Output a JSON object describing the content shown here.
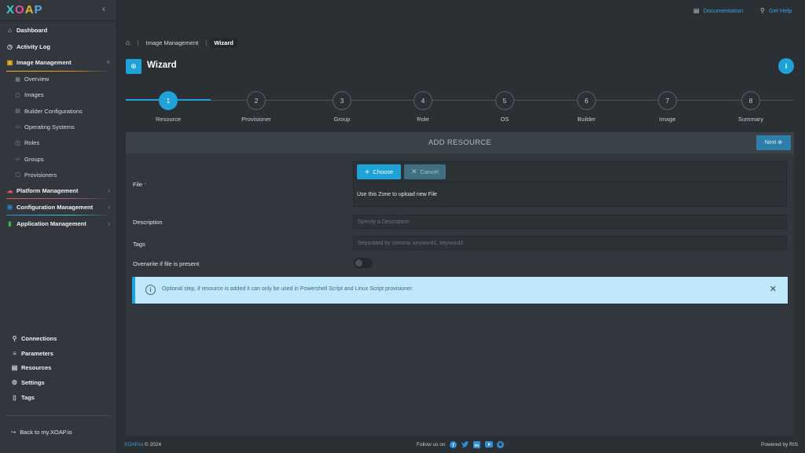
{
  "app": {
    "logo": [
      "X",
      "O",
      "A",
      "P"
    ],
    "collapse_glyph": "‹"
  },
  "sidebar": {
    "main_items": [
      {
        "label": "Dashboard",
        "icon": "home-icon"
      },
      {
        "label": "Activity Log",
        "icon": "clock-icon"
      }
    ],
    "image_management": {
      "label": "Image Management",
      "icon": "layers-icon",
      "accent": "#f0b429",
      "children": [
        {
          "label": "Overview",
          "icon": "grid-icon"
        },
        {
          "label": "Images",
          "icon": "image-icon"
        },
        {
          "label": "Builder Configurations",
          "icon": "file-icon"
        },
        {
          "label": "Operating Systems",
          "icon": "monitor-icon"
        },
        {
          "label": "Roles",
          "icon": "cube-icon"
        },
        {
          "label": "Groups",
          "icon": "folder-icon"
        },
        {
          "label": "Provisioners",
          "icon": "box-icon"
        }
      ]
    },
    "sections": [
      {
        "label": "Platform Management",
        "icon": "cloud-icon",
        "accent": "#e05a4f"
      },
      {
        "label": "Configuration Management",
        "icon": "windows-icon",
        "accent": "#2f8fd8"
      },
      {
        "label": "Application Management",
        "icon": "bar-chart-icon",
        "accent": "#3ab54a"
      }
    ],
    "bottom_items": [
      {
        "label": "Connections",
        "icon": "link-icon"
      },
      {
        "label": "Parameters",
        "icon": "sliders-icon"
      },
      {
        "label": "Resources",
        "icon": "database-icon"
      },
      {
        "label": "Settings",
        "icon": "gear-icon"
      },
      {
        "label": "Tags",
        "icon": "bookmark-icon"
      }
    ],
    "back_link": "Back to my.XOAP.io"
  },
  "topbar": {
    "documentation": "Documentation",
    "get_help": "Get Help"
  },
  "breadcrumb": {
    "items": [
      "Image Management",
      "Wizard"
    ]
  },
  "page": {
    "title": "Wizard",
    "info_glyph": "i"
  },
  "stepper": {
    "current": 1,
    "steps": [
      {
        "number": "1",
        "label": "Resource"
      },
      {
        "number": "2",
        "label": "Provisioner"
      },
      {
        "number": "3",
        "label": "Group"
      },
      {
        "number": "4",
        "label": "Role"
      },
      {
        "number": "5",
        "label": "OS"
      },
      {
        "number": "6",
        "label": "Builder"
      },
      {
        "number": "7",
        "label": "Image"
      },
      {
        "number": "8",
        "label": "Summary"
      }
    ]
  },
  "form": {
    "header": "ADD RESOURCE",
    "next_label": "Next",
    "file_label": "File",
    "required_mark": "*",
    "choose_label": "Choose",
    "cancel_label": "Cancel",
    "upload_hint": "Use this Zone to upload new File",
    "description_label": "Description",
    "description_placeholder": "Specify a Description",
    "description_value": "",
    "tags_label": "Tags",
    "tags_placeholder": "Separated by comma: keyword1, keyword2",
    "tags_value": "",
    "overwrite_label": "Overwrite if file is present",
    "overwrite_on": false,
    "alert_message": "Optional step, if resource is added it can only be used in Powershell Script and Linux Script provisioner."
  },
  "footer": {
    "brand": "XOAP.io",
    "copyright": "© 2024",
    "follow": "Follow us on",
    "social": [
      "facebook-icon",
      "twitter-icon",
      "linkedin-icon",
      "youtube-icon",
      "github-icon"
    ],
    "powered": "Powered by RIS"
  },
  "colors": {
    "accent": "#1ea2d8",
    "background": "#2b3035",
    "sidebar": "#31373d",
    "alert_bg": "#bfe8fa"
  }
}
